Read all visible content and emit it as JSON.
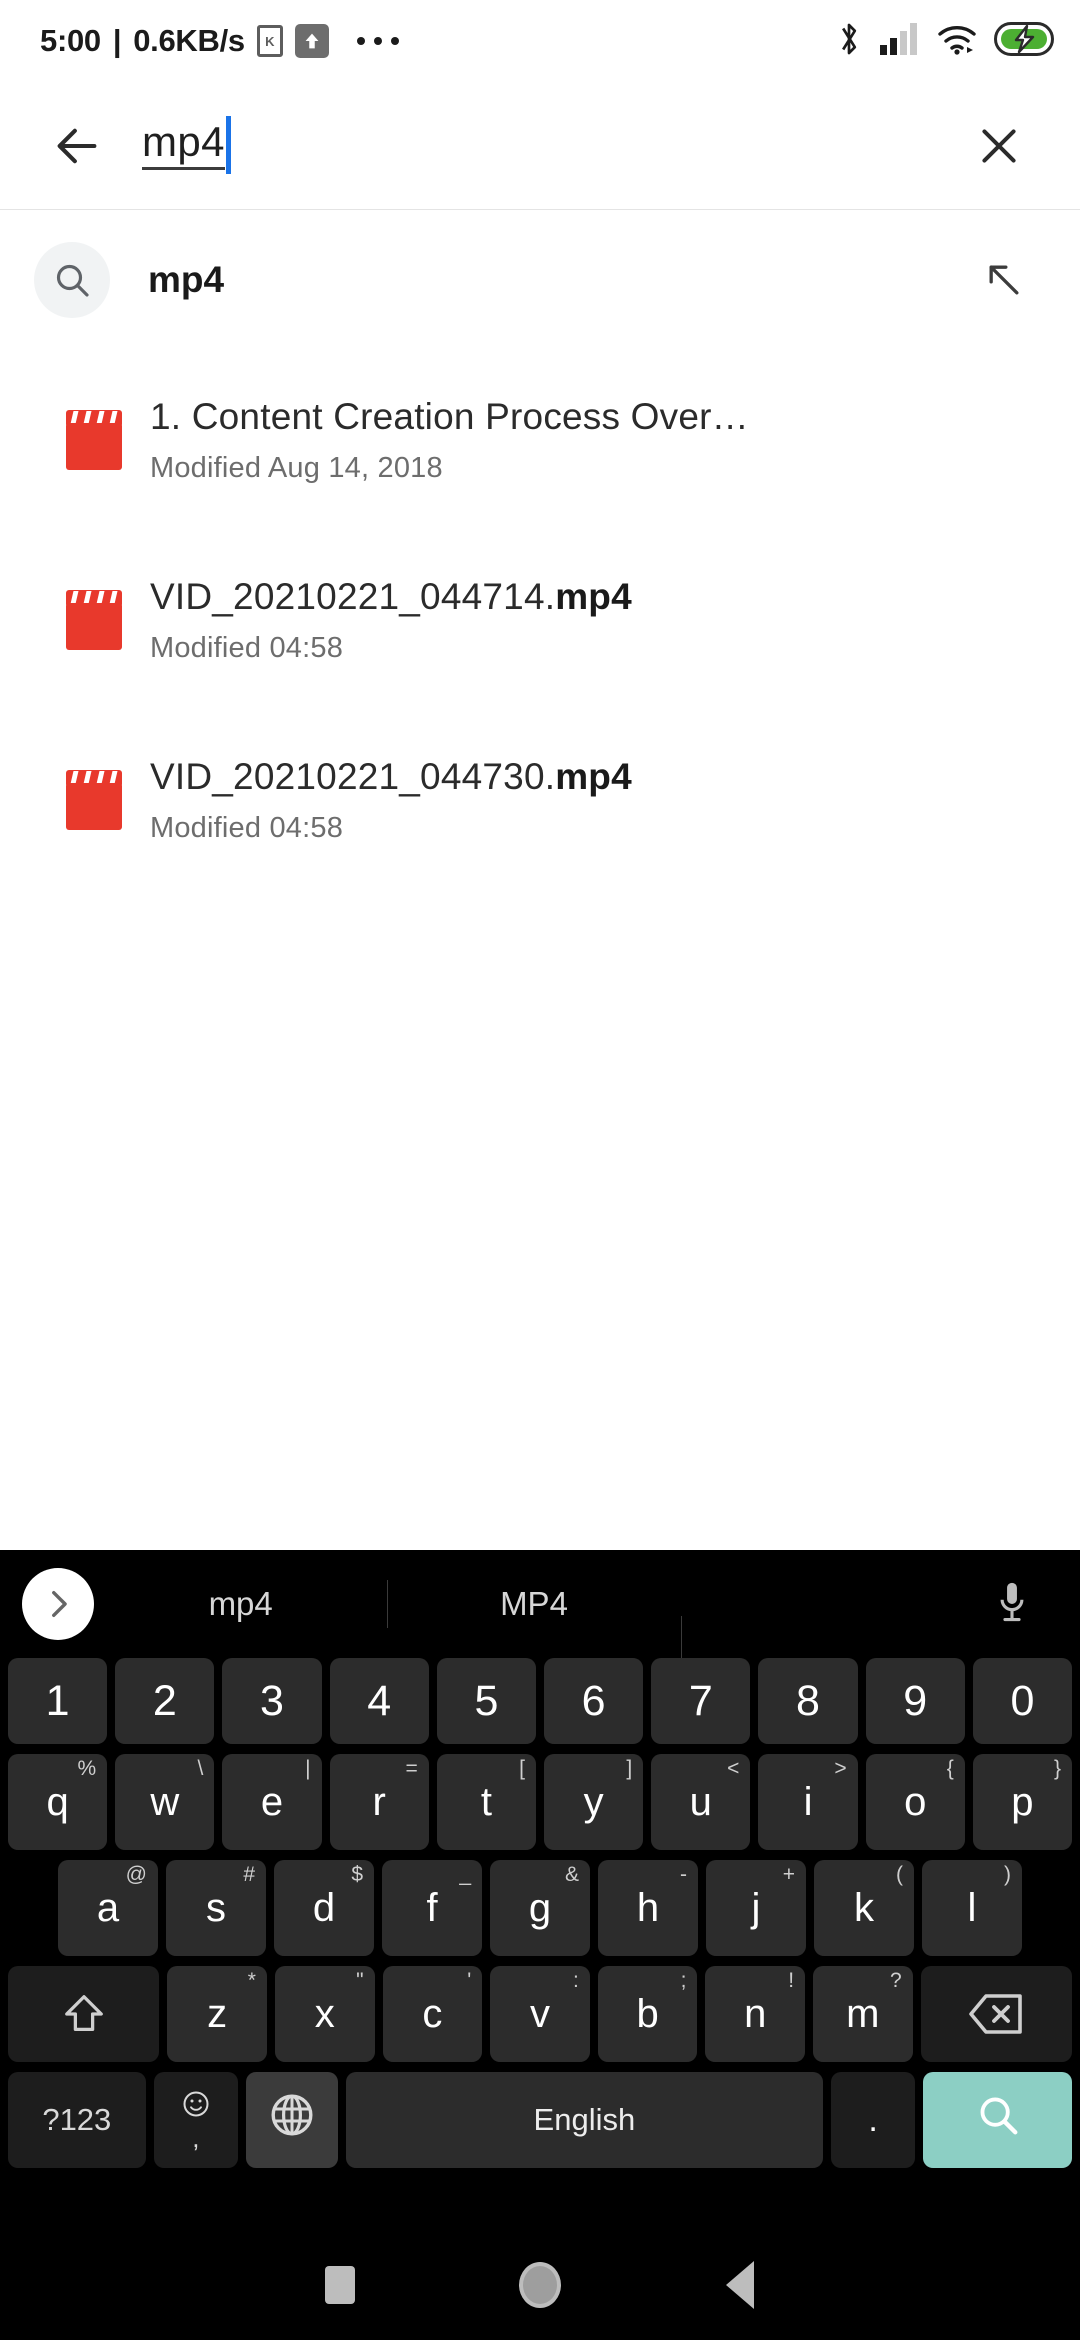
{
  "status_bar": {
    "clock": "5:00",
    "separator": "|",
    "network_speed": "0.6KB/s",
    "vpn_label": "K",
    "icons": [
      "vpn-icon",
      "upload-icon",
      "overflow-dots-icon",
      "bluetooth-icon",
      "cellular-signal-icon",
      "wifi-icon",
      "battery-charging-icon"
    ],
    "signal_bars_filled": 2,
    "signal_bars_total": 4,
    "battery_color": "#4caf32"
  },
  "search_header": {
    "back_icon": "arrow-left-icon",
    "query": "mp4",
    "caret_color": "#1a73e8",
    "clear_icon": "close-icon"
  },
  "suggestion": {
    "icon": "search-icon",
    "label": "mp4",
    "append_icon": "arrow-up-left-icon"
  },
  "results": [
    {
      "icon": "video-file-icon",
      "name_plain": "1. Content Creation Process Over…",
      "name_match": "",
      "modified": "Modified Aug 14, 2018"
    },
    {
      "icon": "video-file-icon",
      "name_plain": "VID_20210221_044714.",
      "name_match": "mp4",
      "modified": "Modified 04:58"
    },
    {
      "icon": "video-file-icon",
      "name_plain": "VID_20210221_044730.",
      "name_match": "mp4",
      "modified": "Modified 04:58"
    }
  ],
  "keyboard": {
    "expand_icon": "chevron-right-icon",
    "mic_icon": "microphone-icon",
    "suggestions": [
      "mp4",
      "MP4",
      ""
    ],
    "row_numbers": [
      {
        "main": "1",
        "alt": ""
      },
      {
        "main": "2",
        "alt": ""
      },
      {
        "main": "3",
        "alt": ""
      },
      {
        "main": "4",
        "alt": ""
      },
      {
        "main": "5",
        "alt": ""
      },
      {
        "main": "6",
        "alt": ""
      },
      {
        "main": "7",
        "alt": ""
      },
      {
        "main": "8",
        "alt": ""
      },
      {
        "main": "9",
        "alt": ""
      },
      {
        "main": "0",
        "alt": ""
      }
    ],
    "row_top": [
      {
        "main": "q",
        "alt": "%"
      },
      {
        "main": "w",
        "alt": "\\"
      },
      {
        "main": "e",
        "alt": "|"
      },
      {
        "main": "r",
        "alt": "="
      },
      {
        "main": "t",
        "alt": "["
      },
      {
        "main": "y",
        "alt": "]"
      },
      {
        "main": "u",
        "alt": "<"
      },
      {
        "main": "i",
        "alt": ">"
      },
      {
        "main": "o",
        "alt": "{"
      },
      {
        "main": "p",
        "alt": "}"
      }
    ],
    "row_home": [
      {
        "main": "a",
        "alt": "@"
      },
      {
        "main": "s",
        "alt": "#"
      },
      {
        "main": "d",
        "alt": "$"
      },
      {
        "main": "f",
        "alt": "_"
      },
      {
        "main": "g",
        "alt": "&"
      },
      {
        "main": "h",
        "alt": "-"
      },
      {
        "main": "j",
        "alt": "+"
      },
      {
        "main": "k",
        "alt": "("
      },
      {
        "main": "l",
        "alt": ")"
      }
    ],
    "row_bottom": [
      {
        "main": "z",
        "alt": "*"
      },
      {
        "main": "x",
        "alt": "\""
      },
      {
        "main": "c",
        "alt": "'"
      },
      {
        "main": "v",
        "alt": ":"
      },
      {
        "main": "b",
        "alt": ";"
      },
      {
        "main": "n",
        "alt": "!"
      },
      {
        "main": "m",
        "alt": "?"
      }
    ],
    "shift_icon": "shift-arrow-icon",
    "backspace_icon": "backspace-icon",
    "symbols_key": "?123",
    "emoji_icon": "emoji-smiley-icon",
    "comma_key": ",",
    "globe_icon": "language-globe-icon",
    "space_label": "English",
    "period_key": ".",
    "enter_icon": "search-icon",
    "enter_color": "#8ccfc4"
  },
  "nav_bar": {
    "recents_icon": "square-recents-icon",
    "home_icon": "circle-home-icon",
    "back_icon": "triangle-back-icon"
  }
}
